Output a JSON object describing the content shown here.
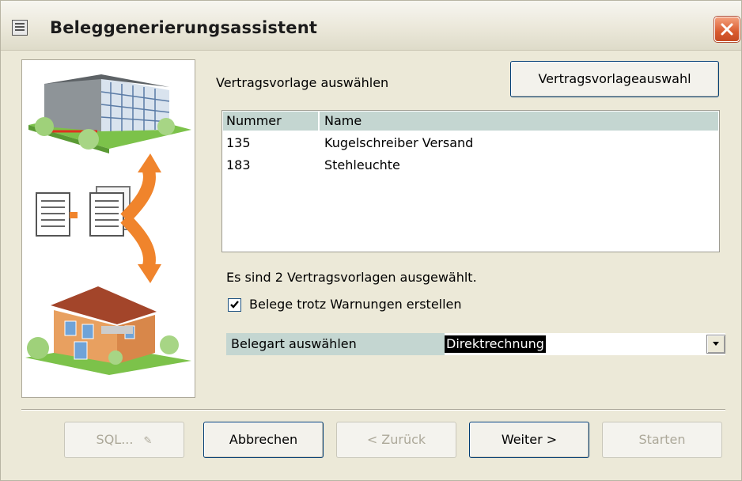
{
  "window": {
    "title": "Beleggenerierungsassistent"
  },
  "main": {
    "select_template_label": "Vertragsvorlage auswählen",
    "select_template_button": "Vertragsvorlageauswahl",
    "list": {
      "columns": [
        "Nummer",
        "Name"
      ],
      "rows": [
        {
          "nummer": "135",
          "name": "Kugelschreiber Versand"
        },
        {
          "nummer": "183",
          "name": "Stehleuchte"
        }
      ]
    },
    "status_text": "Es sind 2 Vertragsvorlagen ausgewählt.",
    "warnings_checkbox": {
      "label": "Belege trotz Warnungen erstellen",
      "checked": true
    },
    "document_type": {
      "label": "Belegart auswählen",
      "value": "Direktrechnung"
    }
  },
  "footer": {
    "sql_button": "SQL...",
    "cancel_button": "Abbrechen",
    "back_button": "< Zurück",
    "next_button": "Weiter >",
    "start_button": "Starten"
  },
  "icons": {
    "app": "form-icon",
    "close": "close-icon",
    "sql": "pencil-icon",
    "checkbox": "checkmark-icon",
    "dropdown": "chevron-down-icon"
  },
  "colors": {
    "dialog_bg": "#ece9d8",
    "header_bg": "#c4d6d1",
    "close_red": "#d95b2f",
    "selection_bg": "#000000"
  }
}
